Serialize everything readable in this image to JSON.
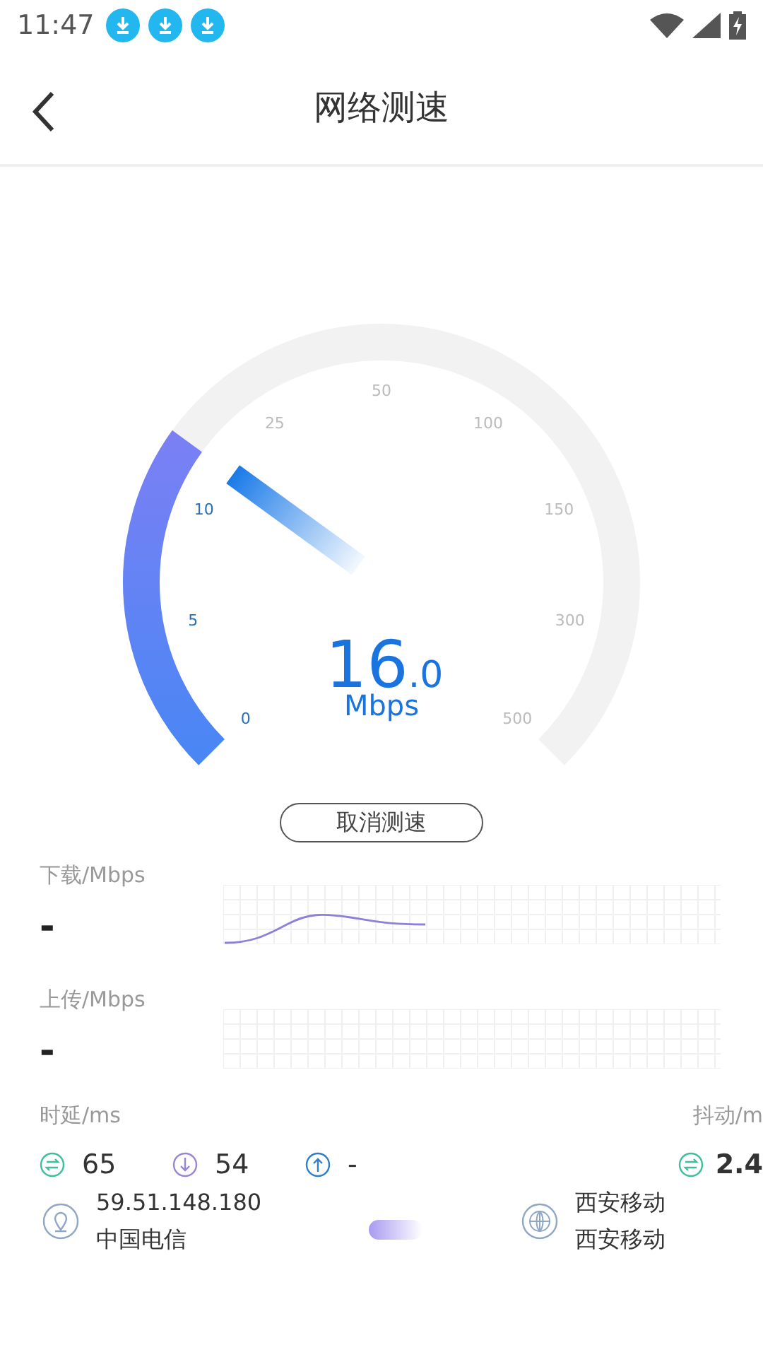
{
  "status_bar": {
    "time": "11:47"
  },
  "header": {
    "title": "网络测速"
  },
  "gauge": {
    "level": 0.3,
    "ticks": [
      {
        "label": "0",
        "passed": true
      },
      {
        "label": "5",
        "passed": true
      },
      {
        "label": "10",
        "passed": true
      },
      {
        "label": "25",
        "passed": false
      },
      {
        "label": "50",
        "passed": false
      },
      {
        "label": "100",
        "passed": false
      },
      {
        "label": "150",
        "passed": false
      },
      {
        "label": "300",
        "passed": false
      },
      {
        "label": "500",
        "passed": false
      }
    ],
    "speed_integer": "16",
    "speed_decimal": ".0",
    "unit": "Mbps"
  },
  "cancel_button": "取消测速",
  "download": {
    "label": "下载/Mbps",
    "value": "-"
  },
  "upload": {
    "label": "上传/Mbps",
    "value": "-"
  },
  "latency": {
    "label": "时延/ms",
    "items": [
      {
        "kind": "ping",
        "value": "65"
      },
      {
        "kind": "down",
        "value": "54"
      },
      {
        "kind": "up",
        "value": "-"
      }
    ]
  },
  "jitter": {
    "label": "抖动/m",
    "value": "2.4"
  },
  "client": {
    "ip": "59.51.148.180",
    "isp": "中国电信"
  },
  "server": {
    "name": "西安移动",
    "isp": "西安移动"
  }
}
